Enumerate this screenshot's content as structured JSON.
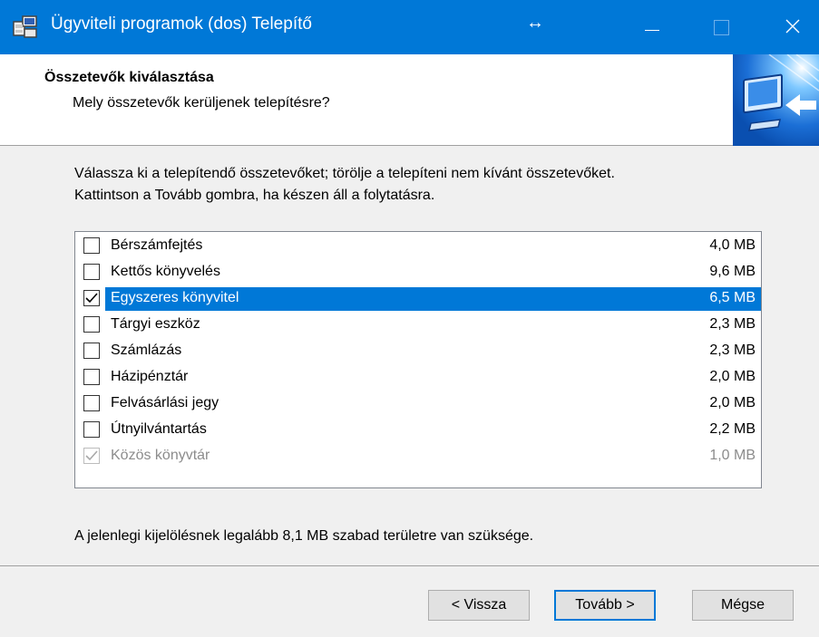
{
  "window": {
    "title": "Ügyviteli programok (dos) Telepítő",
    "title_icon": "installer-icon",
    "accent": "#0078d7"
  },
  "header": {
    "title": "Összetevők kiválasztása",
    "subtitle": "Mely összetevők kerüljenek telepítésre?"
  },
  "description": {
    "line1": "Válassza ki a telepítendő összetevőket; törölje a telepíteni nem kívánt összetevőket.",
    "line2": "Kattintson a Tovább gombra, ha készen áll a folytatásra."
  },
  "components": [
    {
      "label": "Bérszámfejtés",
      "size": "4,0 MB",
      "checked": false,
      "selected": false,
      "disabled": false
    },
    {
      "label": "Kettős könyvelés",
      "size": "9,6 MB",
      "checked": false,
      "selected": false,
      "disabled": false
    },
    {
      "label": "Egyszeres könyvitel",
      "size": "6,5 MB",
      "checked": true,
      "selected": true,
      "disabled": false
    },
    {
      "label": "Tárgyi eszköz",
      "size": "2,3 MB",
      "checked": false,
      "selected": false,
      "disabled": false
    },
    {
      "label": "Számlázás",
      "size": "2,3 MB",
      "checked": false,
      "selected": false,
      "disabled": false
    },
    {
      "label": "Házipénztár",
      "size": "2,0 MB",
      "checked": false,
      "selected": false,
      "disabled": false
    },
    {
      "label": "Felvásárlási jegy",
      "size": "2,0 MB",
      "checked": false,
      "selected": false,
      "disabled": false
    },
    {
      "label": "Útnyilvántartás",
      "size": "2,2 MB",
      "checked": false,
      "selected": false,
      "disabled": false
    },
    {
      "label": "Közös könyvtár",
      "size": "1,0 MB",
      "checked": true,
      "selected": false,
      "disabled": true
    }
  ],
  "space_required": "A jelenlegi kijelölésnek legalább 8,1 MB szabad területre van szüksége.",
  "buttons": {
    "back": "< Vissza",
    "next": "Tovább >",
    "cancel": "Mégse"
  }
}
